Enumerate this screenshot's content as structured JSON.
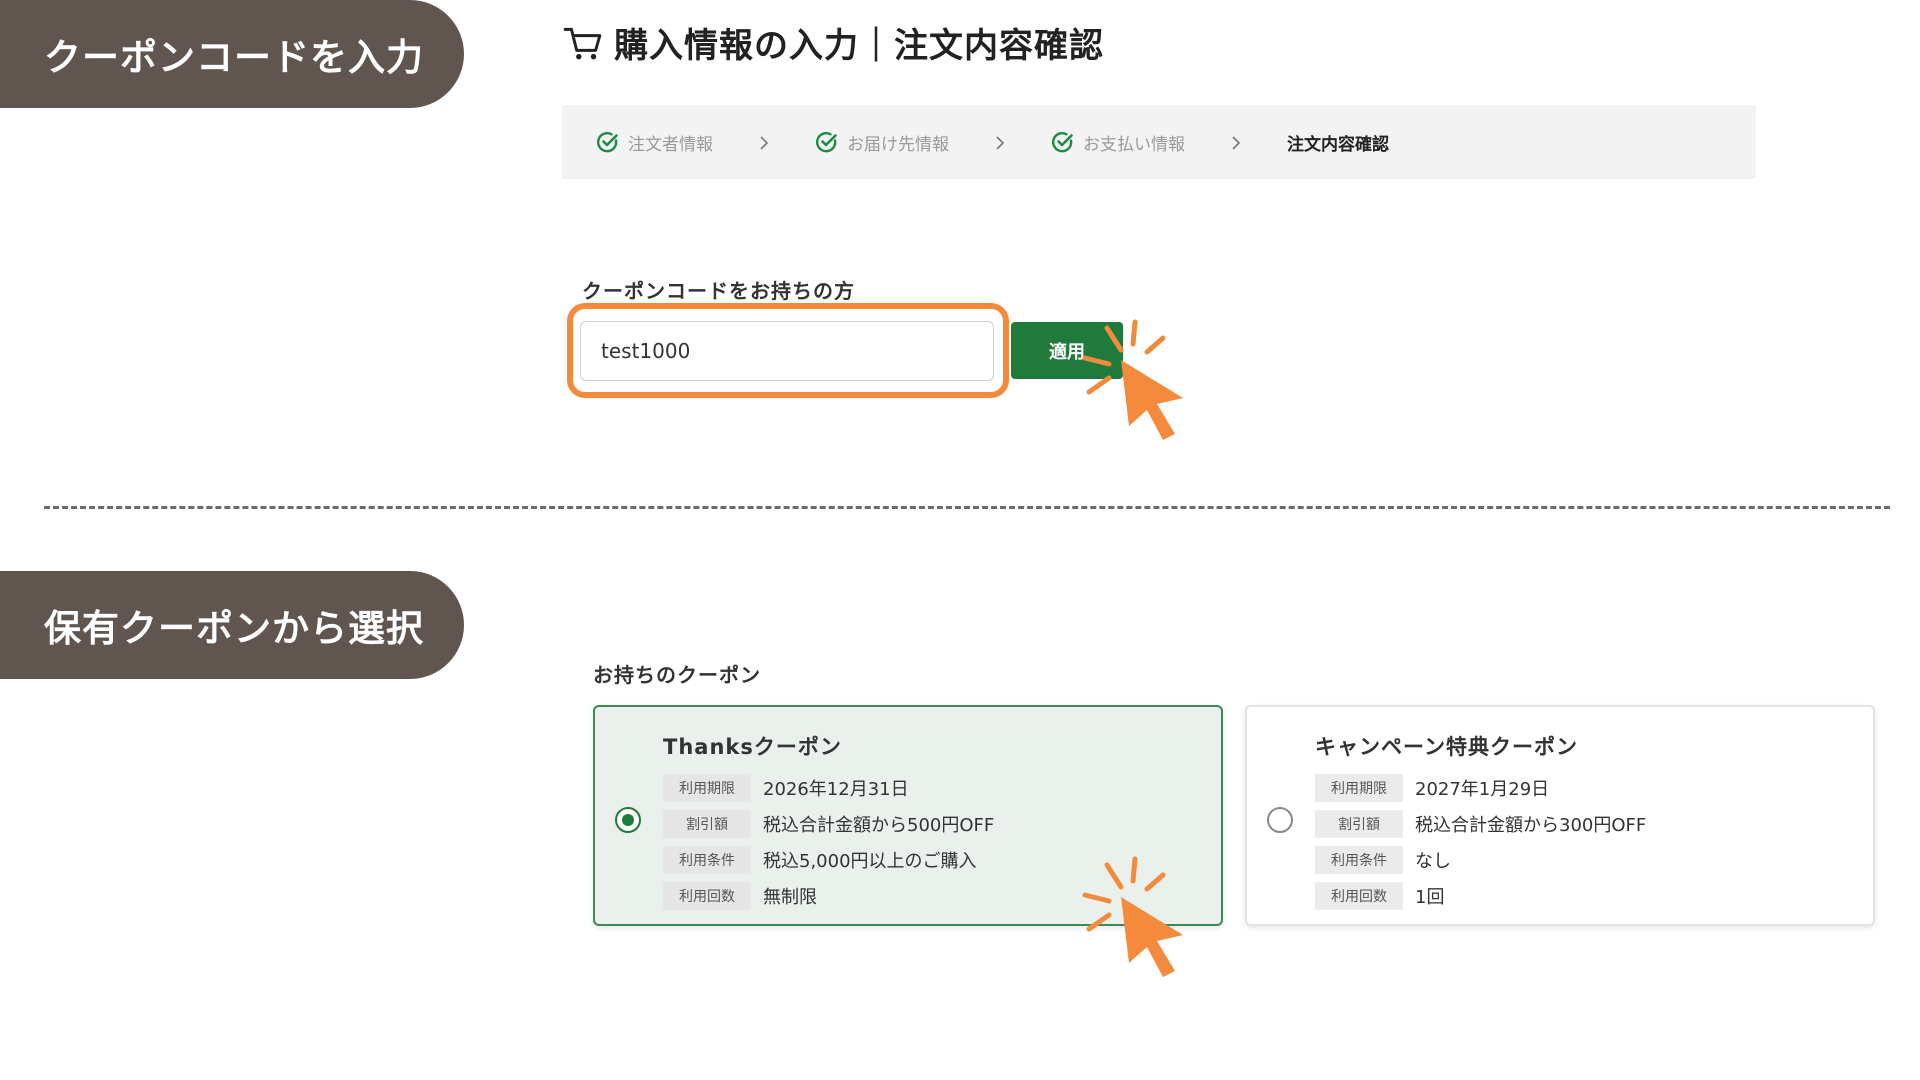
{
  "sections": {
    "coupon_entry_tag": "クーポンコードを入力",
    "coupon_select_tag": "保有クーポンから選択"
  },
  "header": {
    "title": "購入情報の入力｜注文内容確認"
  },
  "stepper": {
    "steps": [
      {
        "label": "注文者情報",
        "status": "done"
      },
      {
        "label": "お届け先情報",
        "status": "done"
      },
      {
        "label": "お支払い情報",
        "status": "done"
      },
      {
        "label": "注文内容確認",
        "status": "current"
      }
    ]
  },
  "coupon_code": {
    "label": "クーポンコードをお持ちの方",
    "value": "test1000",
    "apply_label": "適用"
  },
  "my_coupons": {
    "label": "お持ちのクーポン",
    "coupons": [
      {
        "name": "Thanksクーポン",
        "selected": true,
        "rows": [
          {
            "label": "利用期限",
            "value": "2026年12月31日"
          },
          {
            "label": "割引額",
            "value": "税込合計金額から500円OFF"
          },
          {
            "label": "利用条件",
            "value": "税込5,000円以上のご購入"
          },
          {
            "label": "利用回数",
            "value": "無制限"
          }
        ]
      },
      {
        "name": "キャンペーン特典クーポン",
        "selected": false,
        "rows": [
          {
            "label": "利用期限",
            "value": "2027年1月29日"
          },
          {
            "label": "割引額",
            "value": "税込合計金額から300円OFF"
          },
          {
            "label": "利用条件",
            "value": "なし"
          },
          {
            "label": "利用回数",
            "value": "1回"
          }
        ]
      }
    ]
  },
  "colors": {
    "tag_bg": "#615550",
    "accent_green": "#1f7a3c",
    "highlight_orange": "#f48a3c",
    "selected_card_bg": "#eaf1ec"
  },
  "icons": {
    "cart": "shopping-cart-icon",
    "step_done": "check-circle-icon",
    "step_separator": "chevron-right-icon",
    "pointer": "click-pointer-icon"
  }
}
